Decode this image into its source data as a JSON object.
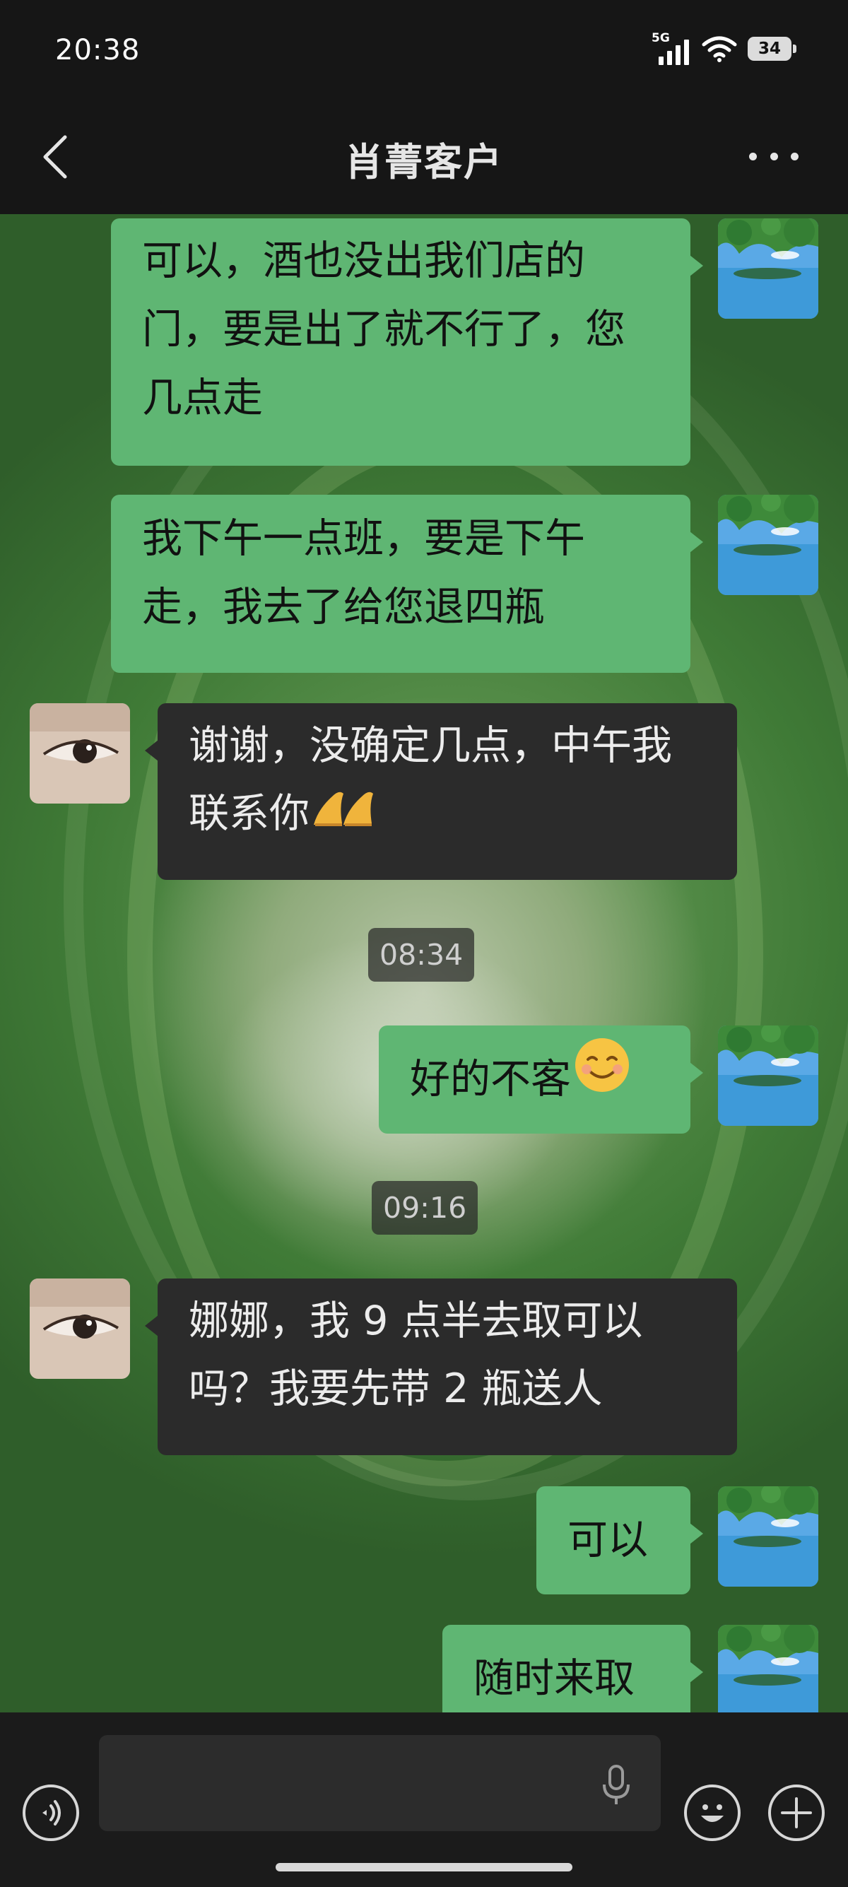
{
  "status_bar": {
    "time": "20:38",
    "network": "5G",
    "battery": "34"
  },
  "header": {
    "title": "肖菁客户",
    "back_icon": "chevron-left-icon",
    "more_icon": "more-dots-icon"
  },
  "messages": [
    {
      "side": "out",
      "lines": [
        "可以，酒也没出我们店的",
        "门，要是出了就不行了，您",
        "几点走"
      ]
    },
    {
      "side": "out",
      "lines": [
        "我下午一点班，要是下午",
        "走，我去了给您退四瓶"
      ]
    },
    {
      "side": "in",
      "lines": [
        "谢谢，没确定几点，中午我",
        "联系你"
      ],
      "emoji": "folded-hands-icon"
    },
    {
      "timestamp": "08:34"
    },
    {
      "side": "out",
      "lines": [
        "好的不客"
      ],
      "emoji": "smiling-face-icon"
    },
    {
      "timestamp": "09:16"
    },
    {
      "side": "in",
      "lines": [
        "娜娜，我 9 点半去取可以",
        "吗？我要先带 2 瓶送人"
      ]
    },
    {
      "side": "out",
      "lines": [
        "可以"
      ]
    },
    {
      "side": "out",
      "lines": [
        "随时来取"
      ]
    }
  ],
  "input_bar": {
    "voice_icon": "voice-icon",
    "mic_icon": "microphone-icon",
    "emoji_icon": "emoji-face-icon",
    "add_icon": "plus-icon",
    "placeholder": ""
  },
  "colors": {
    "outgoing_bubble": "#5fb673",
    "incoming_bubble": "#2b2b2b",
    "top_bar": "#161616",
    "bottom_bar": "#1b1b1b"
  }
}
